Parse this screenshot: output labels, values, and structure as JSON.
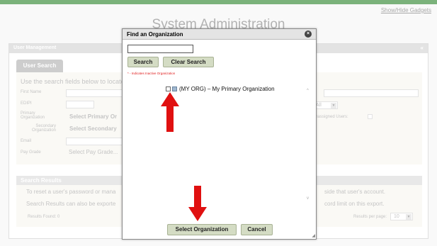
{
  "page": {
    "show_hide_gadgets": "Show/Hide Gadgets",
    "title": "System Administration",
    "user_management": "User Management",
    "collapse_glyph": "«",
    "tab_user_search": "User Search",
    "intro": "Use the search fields below to locate",
    "fields": {
      "first_name": "First Name",
      "edipi": "EDIPI",
      "primary_org_line1": "Primary",
      "primary_org_line2": "Organization",
      "secondary_org_line1": "Secondary",
      "secondary_org_line2": "Organization",
      "email": "Email",
      "pay_grade": "Pay Grade"
    },
    "select_primary_org": "Select Primary Or",
    "select_secondary_org": "Select Secondary",
    "pay_grade_placeholder": "Select Pay Grade...",
    "status_select": "All",
    "unassigned_users": "Unassigned Users:",
    "search_results": "Search Results",
    "reset_text": "To reset a user's password or mana",
    "reset_text_right": "side that user's account.",
    "export_text": "Search Results can also be exporte",
    "export_text_right": "cord limit on this export.",
    "results_found": "Results Found: 0",
    "results_per_page": "Results per page:",
    "results_per_page_value": "10"
  },
  "modal": {
    "title": "Find an Organization",
    "close_glyph": "×",
    "search_value": "",
    "search_button": "Search",
    "clear_button": "Clear Search",
    "inactive_note": "* - Indicates Inactive Organization",
    "tree": [
      {
        "label": "(MY ORG) – My Primary Organization",
        "checked": false
      }
    ],
    "select_button": "Select Organization",
    "cancel_button": "Cancel"
  },
  "colors": {
    "header_green": "#1d7a1d",
    "button_bg": "#d4dcc4",
    "arrow_red": "#e01010",
    "inactive_red": "#e02020"
  }
}
